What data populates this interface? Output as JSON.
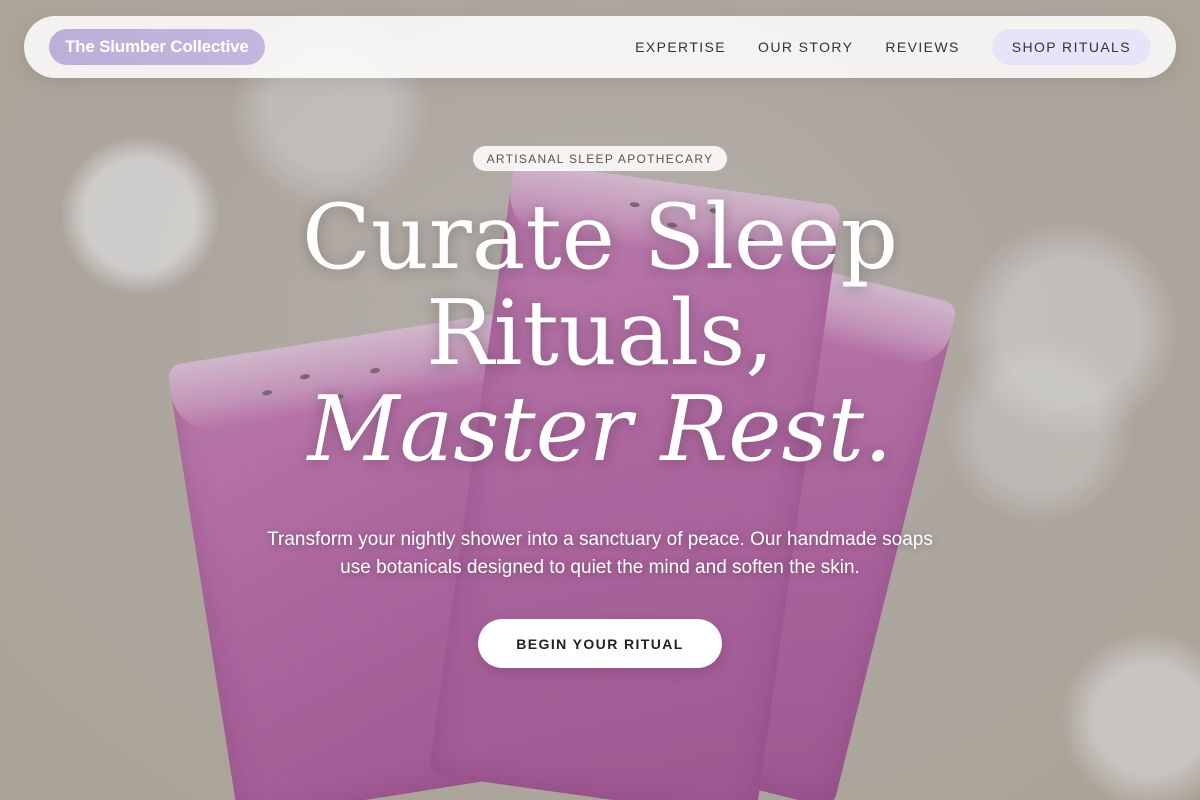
{
  "brand": {
    "name": "The Slumber Collective"
  },
  "nav": {
    "links": [
      {
        "label": "EXPERTISE"
      },
      {
        "label": "OUR STORY"
      },
      {
        "label": "REVIEWS"
      }
    ],
    "cta_label": "SHOP RITUALS"
  },
  "hero": {
    "eyebrow": "ARTISANAL SLEEP APOTHECARY",
    "headline": {
      "line1": "Curate Sleep",
      "line2": "Rituals,",
      "line3": "Master Rest."
    },
    "subtext": "Transform your nightly shower into a sanctuary of peace. Our handmade soaps use botanicals designed to quiet the mind and soften the skin.",
    "cta_label": "BEGIN YOUR RITUAL"
  },
  "colors": {
    "brand_pill": "#bcaed8",
    "nav_cta_bg": "#e7e4fa",
    "hero_text": "#ffffff"
  }
}
